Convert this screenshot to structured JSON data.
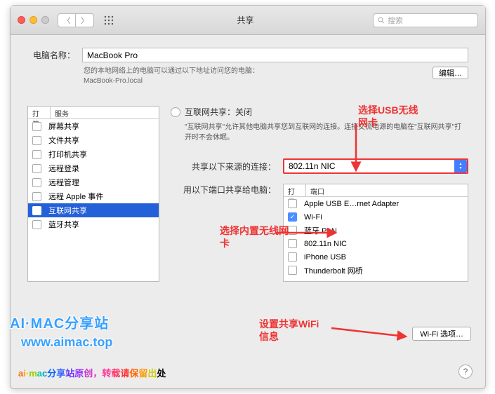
{
  "title": "共享",
  "search_placeholder": "搜索",
  "computer_name": {
    "label": "电脑名称：",
    "value": "MacBook Pro",
    "hint": "您的本地网络上的电脑可以通过以下地址访问您的电脑：",
    "host": "MacBook-Pro.local",
    "edit": "编辑…"
  },
  "sidebar": {
    "head": {
      "on": "打开",
      "service": "服务"
    },
    "items": [
      {
        "label": "屏幕共享",
        "checked": false,
        "selected": false
      },
      {
        "label": "文件共享",
        "checked": false,
        "selected": false
      },
      {
        "label": "打印机共享",
        "checked": false,
        "selected": false
      },
      {
        "label": "远程登录",
        "checked": false,
        "selected": false
      },
      {
        "label": "远程管理",
        "checked": false,
        "selected": false
      },
      {
        "label": "远程 Apple 事件",
        "checked": false,
        "selected": false
      },
      {
        "label": "互联网共享",
        "checked": false,
        "selected": true
      },
      {
        "label": "蓝牙共享",
        "checked": false,
        "selected": false
      }
    ]
  },
  "internet_share": {
    "heading": "互联网共享：关闭",
    "desc": "\"互联网共享\"允许其他电脑共享您到互联网的连接。连接交流电源的电脑在\"互联网共享\"打开时不会休眠。",
    "from_label": "共享以下来源的连接：",
    "from_value": "802.11n NIC",
    "to_label": "用以下端口共享给电脑：",
    "port_head": {
      "on": "打开",
      "port": "端口"
    },
    "ports": [
      {
        "label": "Apple USB E…rnet Adapter",
        "checked": false
      },
      {
        "label": "Wi-Fi",
        "checked": true
      },
      {
        "label": "蓝牙 PAN",
        "checked": false
      },
      {
        "label": "802.11n NIC",
        "checked": false
      },
      {
        "label": "iPhone USB",
        "checked": false
      },
      {
        "label": "Thunderbolt 网桥",
        "checked": false
      }
    ],
    "wifi_options": "Wi-Fi 选项…"
  },
  "annotations": {
    "a1": "选择USB无线网卡",
    "a2": "选择内置无线网卡",
    "a3": "设置共享WiFi信息"
  },
  "watermark": {
    "w1": "AI·MAC分享站",
    "w2": "www.aimac.top",
    "w3": "ai·mac分享站原创，转载请保留出处"
  }
}
